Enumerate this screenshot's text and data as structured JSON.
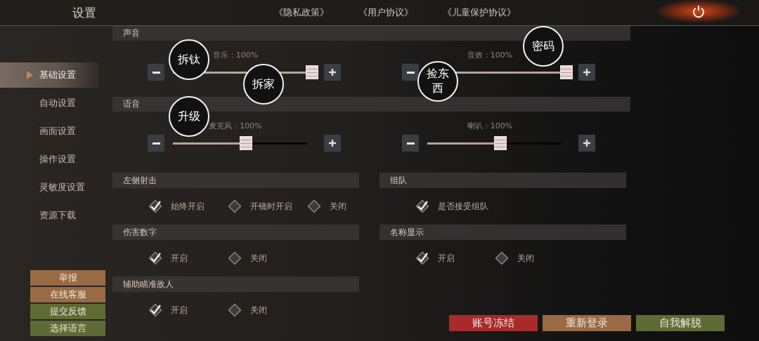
{
  "header": {
    "title": "设置",
    "links": [
      "《隐私政策》",
      "《用户协议》",
      "《儿童保护协议》"
    ]
  },
  "sidebar": {
    "items": [
      {
        "label": "基础设置",
        "selected": true
      },
      {
        "label": "自动设置",
        "selected": false
      },
      {
        "label": "画面设置",
        "selected": false
      },
      {
        "label": "操作设置",
        "selected": false
      },
      {
        "label": "灵敏度设置",
        "selected": false
      },
      {
        "label": "资源下载",
        "selected": false
      }
    ],
    "buttons": [
      {
        "label": "举报",
        "color": "#9a6a44"
      },
      {
        "label": "在线客服",
        "color": "#9a6a44"
      },
      {
        "label": "提交反馈",
        "color": "#5f6b34"
      },
      {
        "label": "选择语言",
        "color": "#5f6b34"
      }
    ]
  },
  "slider_sections": [
    {
      "title": "声音",
      "sliders": [
        {
          "label": "音乐：100%",
          "level": 1
        },
        {
          "label": "音效：100%",
          "level": 1
        }
      ]
    },
    {
      "title": "语音",
      "sliders": [
        {
          "label": "麦克风：100%",
          "level": 0.5
        },
        {
          "label": "喇叭：100%",
          "level": 0.5
        }
      ]
    }
  ],
  "option_columns": [
    [
      {
        "title": "左侧射击",
        "options": [
          {
            "label": "始终开启",
            "checked": true
          },
          {
            "label": "开镜时开启",
            "checked": false
          },
          {
            "label": "关闭",
            "checked": false
          }
        ]
      },
      {
        "title": "伤害数字",
        "options": [
          {
            "label": "开启",
            "checked": true
          },
          {
            "label": "关闭",
            "checked": false
          }
        ]
      },
      {
        "title": "辅助瞄准敌人",
        "options": [
          {
            "label": "开启",
            "checked": true
          },
          {
            "label": "关闭",
            "checked": false
          }
        ]
      }
    ],
    [
      {
        "title": "组队",
        "options": [
          {
            "label": "是否接受组队",
            "checked": true
          }
        ]
      },
      {
        "title": "名称显示",
        "options": [
          {
            "label": "开启",
            "checked": true
          },
          {
            "label": "关闭",
            "checked": false
          }
        ]
      }
    ]
  ],
  "footer_buttons": [
    {
      "label": "账号冻结",
      "color": "#a82a2a"
    },
    {
      "label": "重新登录",
      "color": "#9a6a44"
    },
    {
      "label": "自我解脱",
      "color": "#5f6b34"
    }
  ],
  "bubbles": [
    {
      "label": "拆钛"
    },
    {
      "label": "拆家"
    },
    {
      "label": "升级"
    },
    {
      "label": "捡东西"
    },
    {
      "label": "密码"
    }
  ]
}
